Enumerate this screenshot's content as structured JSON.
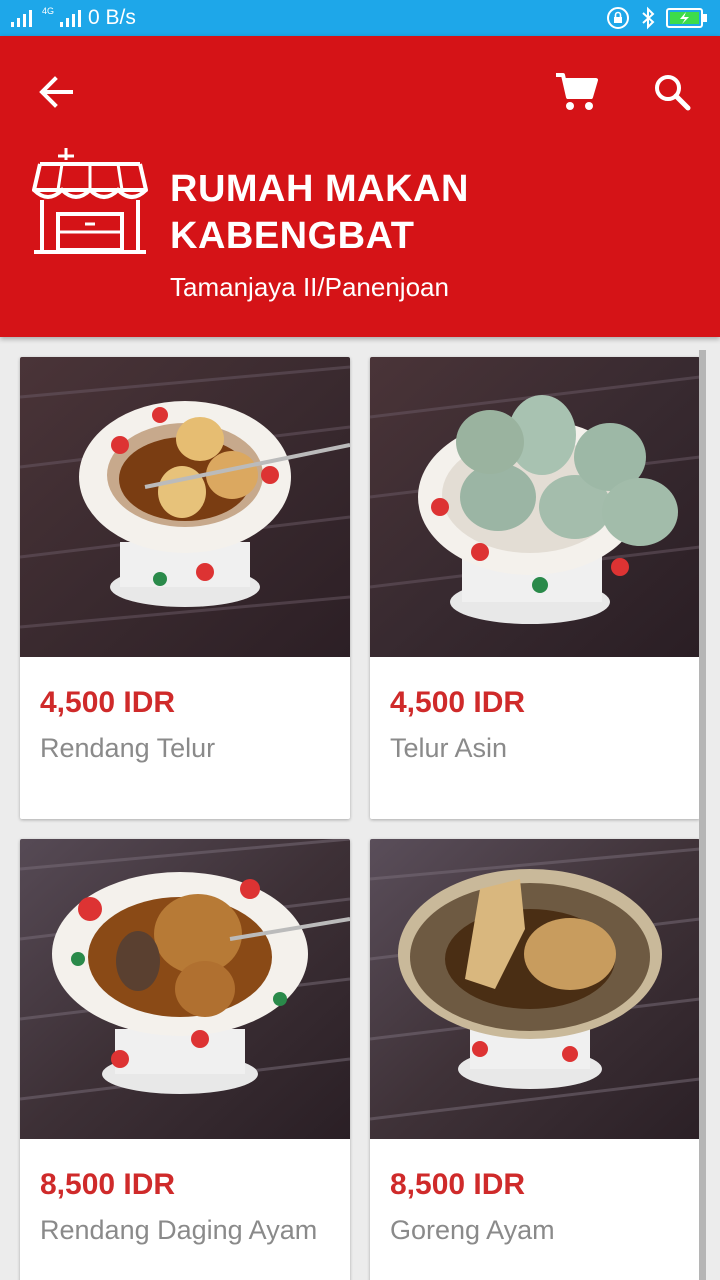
{
  "status_bar": {
    "network": "4G",
    "speed": "0 B/s"
  },
  "toolbar": {
    "back_icon": "arrow-left-icon",
    "cart_icon": "shopping-cart-icon",
    "search_icon": "search-icon"
  },
  "store": {
    "icon": "storefront-icon",
    "name": "RUMAH MAKAN KABENGBAT",
    "location": "Tamanjaya II/Panenjoan"
  },
  "colors": {
    "status_bar": "#1ea7e9",
    "header": "#d51317",
    "price": "#cf2a2a",
    "product_name": "#8a8a8a",
    "background": "#ececec"
  },
  "products": [
    {
      "price": "4,500 IDR",
      "name": "Rendang Telur"
    },
    {
      "price": "4,500 IDR",
      "name": "Telur Asin"
    },
    {
      "price": "8,500 IDR",
      "name": "Rendang Daging Ayam"
    },
    {
      "price": "8,500 IDR",
      "name": "Goreng Ayam"
    }
  ]
}
